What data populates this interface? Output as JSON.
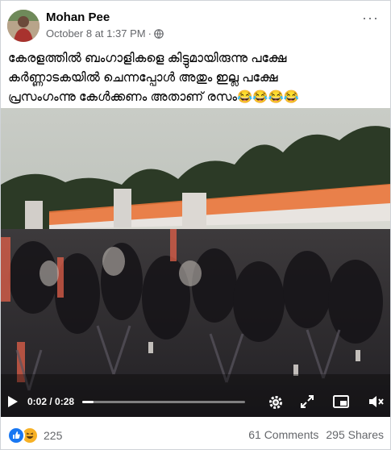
{
  "post": {
    "author": "Mohan Pee",
    "date": "October 8 at 1:37 PM",
    "separator": "·",
    "more_label": "···",
    "caption_lines": [
      "കേരളത്തിൽ ബംഗാളികളെ കിട്ടുമായിരുന്നു പക്ഷേ",
      "കർണ്ണാടകയിൽ ചെന്നപ്പോൾ അതും ഇല്ല പക്ഷേ",
      "പ്രസംഗംന്നു കേൾക്കണം അതാണ് രസം😂😂😂😂"
    ],
    "icons": {
      "privacy": "globe-icon",
      "more": "more-options-icon"
    }
  },
  "video": {
    "current_time": "0:02",
    "duration": "0:28",
    "time_separator": " / ",
    "progress": 0.07,
    "icons": [
      "play-icon",
      "settings-icon",
      "fullscreen-icon",
      "picture-in-picture-icon",
      "mute-icon"
    ]
  },
  "footer": {
    "reaction_count": "225",
    "comments": "61 Comments",
    "shares": "295 Shares",
    "reactions": [
      "like",
      "haha"
    ],
    "colors": {
      "like": "#1877f2",
      "haha": "#f7b125"
    }
  }
}
